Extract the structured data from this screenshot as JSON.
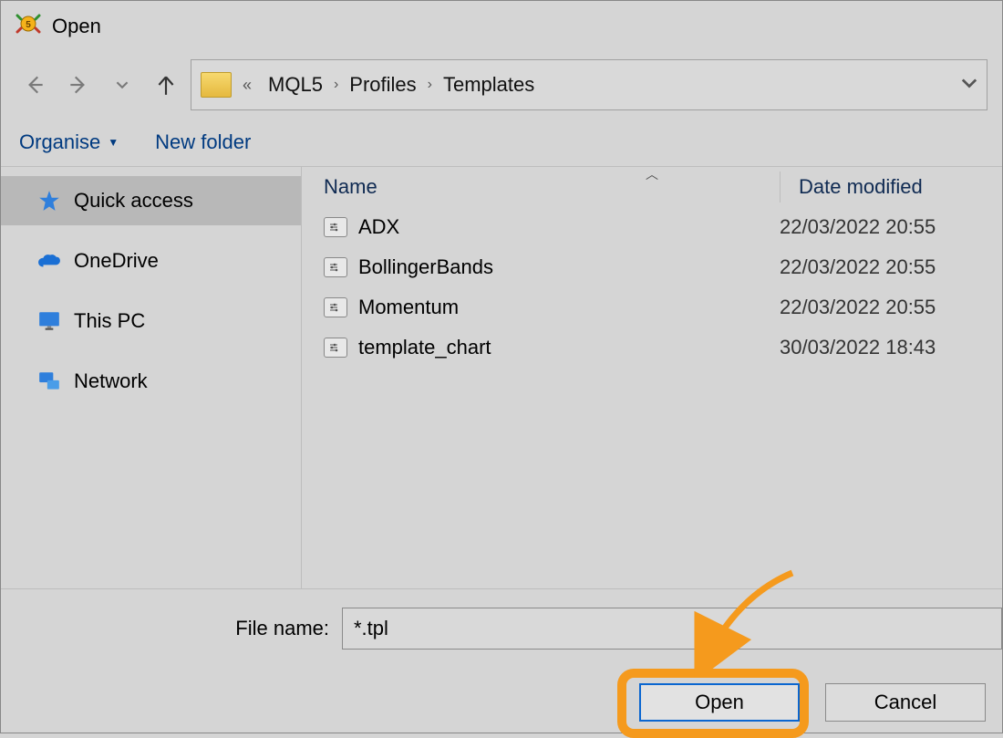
{
  "title": "Open",
  "breadcrumbs": [
    "MQL5",
    "Profiles",
    "Templates"
  ],
  "toolbar": {
    "organise": "Organise",
    "new_folder": "New folder"
  },
  "sidebar": {
    "quick_access": "Quick access",
    "onedrive": "OneDrive",
    "this_pc": "This PC",
    "network": "Network"
  },
  "columns": {
    "name": "Name",
    "date": "Date modified"
  },
  "files": [
    {
      "name": "ADX",
      "date": "22/03/2022 20:55"
    },
    {
      "name": "BollingerBands",
      "date": "22/03/2022 20:55"
    },
    {
      "name": "Momentum",
      "date": "22/03/2022 20:55"
    },
    {
      "name": "template_chart",
      "date": "30/03/2022 18:43"
    }
  ],
  "filename": {
    "label": "File name:",
    "value": "*.tpl"
  },
  "buttons": {
    "open": "Open",
    "cancel": "Cancel"
  }
}
